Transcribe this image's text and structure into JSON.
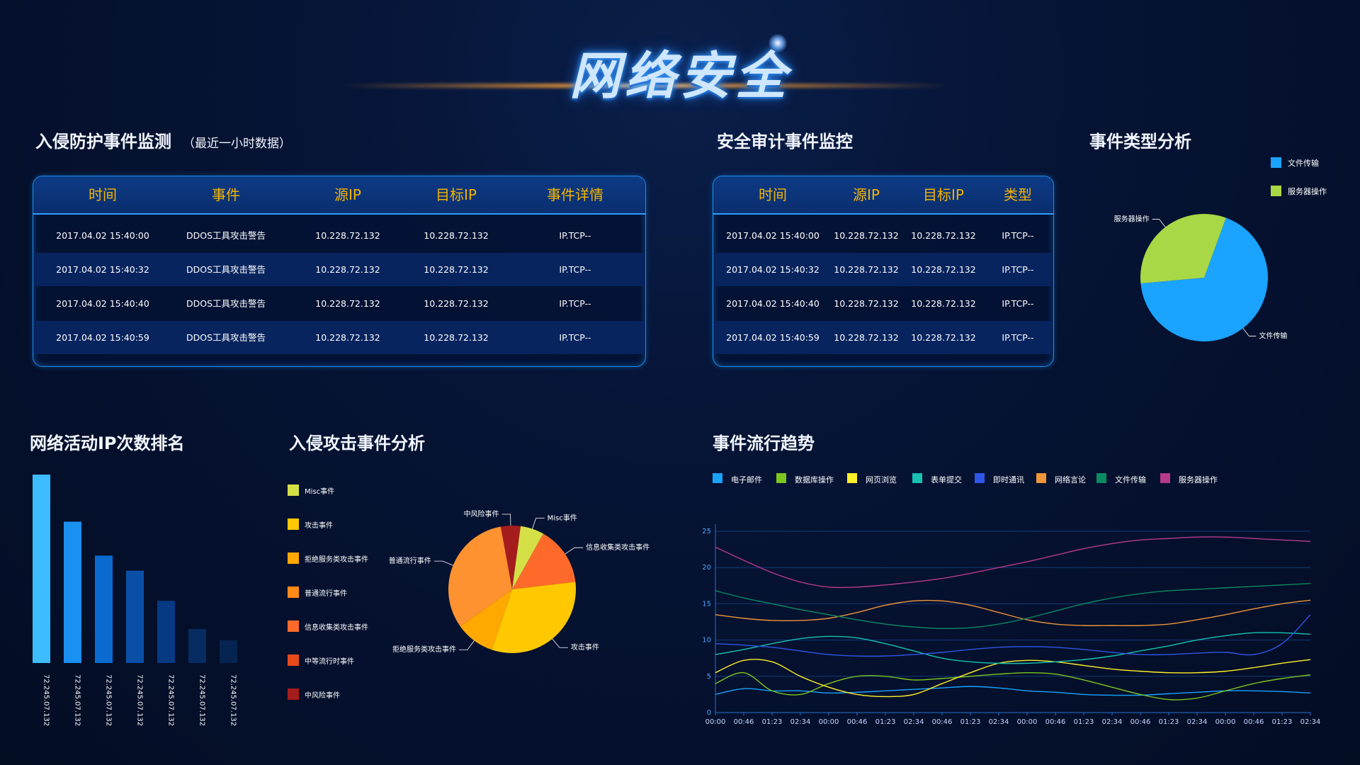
{
  "header": {
    "title": "网络安全"
  },
  "intrusion": {
    "title": "入侵防护事件监测",
    "subtitle": "（最近一小时数据）",
    "columns": [
      "时间",
      "事件",
      "源IP",
      "目标IP",
      "事件详情"
    ],
    "rows": [
      [
        "2017.04.02  15:40:00",
        "DDOS工具攻击警告",
        "10.228.72.132",
        "10.228.72.132",
        "IP.TCP--"
      ],
      [
        "2017.04.02  15:40:32",
        "DDOS工具攻击警告",
        "10.228.72.132",
        "10.228.72.132",
        "IP.TCP--"
      ],
      [
        "2017.04.02  15:40:40",
        "DDOS工具攻击警告",
        "10.228.72.132",
        "10.228.72.132",
        "IP.TCP--"
      ],
      [
        "2017.04.02  15:40:59",
        "DDOS工具攻击警告",
        "10.228.72.132",
        "10.228.72.132",
        "IP.TCP--"
      ]
    ]
  },
  "audit": {
    "title": "安全审计事件监控",
    "columns": [
      "时间",
      "源IP",
      "目标IP",
      "类型"
    ],
    "rows": [
      [
        "2017.04.02  15:40:00",
        "10.228.72.132",
        "10.228.72.132",
        "IP.TCP--"
      ],
      [
        "2017.04.02  15:40:32",
        "10.228.72.132",
        "10.228.72.132",
        "IP.TCP--"
      ],
      [
        "2017.04.02  15:40:40",
        "10.228.72.132",
        "10.228.72.132",
        "IP.TCP--"
      ],
      [
        "2017.04.02  15:40:59",
        "10.228.72.132",
        "10.228.72.132",
        "IP.TCP--"
      ]
    ]
  },
  "event_type": {
    "title": "事件类型分析"
  },
  "ip_rank": {
    "title": "网络活动IP次数排名"
  },
  "attack": {
    "title": "入侵攻击事件分析"
  },
  "trend": {
    "title": "事件流行趋势"
  },
  "chart_data": [
    {
      "type": "pie",
      "labels": [
        "文件传输",
        "服务器操作"
      ],
      "values": [
        68,
        32
      ],
      "colors": [
        "#1aa3ff",
        "#a8d845"
      ],
      "legend": [
        "文件传输",
        "服务器操作"
      ],
      "legend_position": "top-right"
    },
    {
      "type": "bar",
      "categories": [
        "72.245.07.132",
        "72.245.07.132",
        "72.245.07.132",
        "72.245.07.132",
        "72.245.07.132",
        "72.245.07.132",
        "72.245.07.132"
      ],
      "values": [
        100,
        75,
        57,
        49,
        33,
        18,
        12
      ],
      "colors": [
        "#3dbcff",
        "#1a90f0",
        "#0a6ad0",
        "#0a4fa6",
        "#073a82",
        "#062c62",
        "#052450"
      ]
    },
    {
      "type": "pie",
      "labels": [
        "中风险事件",
        "Misc事件",
        "信息收集类攻击事件",
        "攻击事件",
        "拒绝服务类攻击事件",
        "普通流行事件",
        "中等流行时事件"
      ],
      "values": [
        5,
        6,
        15,
        32,
        10,
        32,
        0
      ],
      "colors": [
        "#a51c1c",
        "#d4e046",
        "#ff6a2a",
        "#ffc800",
        "#ffa800",
        "#ff9230",
        "#e64a1a"
      ],
      "legend": [
        "Misc事件",
        "攻击事件",
        "拒绝服务类攻击事件",
        "普通流行事件",
        "信息收集类攻击事件",
        "中等流行时事件",
        "中风险事件"
      ],
      "legend_colors": [
        "#d4e046",
        "#ffc800",
        "#ffa800",
        "#ff8a18",
        "#ff6a2a",
        "#e84a1c",
        "#a51c1c"
      ],
      "legend_position": "left"
    },
    {
      "type": "line",
      "x": [
        "00:00",
        "00:46",
        "01:23",
        "02:34",
        "00:00",
        "00:46",
        "01:23",
        "02:34",
        "00:46",
        "01:23",
        "02:34",
        "00:00",
        "00:46",
        "01:23",
        "02:34",
        "00:46",
        "01:23",
        "02:34",
        "00:00",
        "00:46",
        "01:23",
        "02:34"
      ],
      "ylim": [
        0,
        25
      ],
      "yticks": [
        0,
        5,
        10,
        15,
        20,
        25
      ],
      "series": [
        {
          "name": "电子邮件",
          "color": "#1aa3ff",
          "values": [
            2.5,
            3.3,
            3.0,
            3.0,
            2.7,
            2.8,
            3.0,
            3.2,
            3.4,
            3.6,
            3.4,
            3.0,
            2.8,
            2.5,
            2.4,
            2.4,
            2.6,
            2.8,
            3.0,
            3.0,
            2.9,
            2.7
          ]
        },
        {
          "name": "数据库操作",
          "color": "#7cc620",
          "values": [
            4.0,
            5.5,
            3.0,
            2.5,
            4.0,
            5.0,
            5.0,
            4.5,
            4.7,
            5.0,
            5.3,
            5.5,
            5.3,
            4.5,
            3.5,
            2.5,
            1.8,
            2.0,
            3.0,
            4.0,
            4.7,
            5.2
          ]
        },
        {
          "name": "网页浏览",
          "color": "#ffef2a",
          "values": [
            5.5,
            7.2,
            7.0,
            5.0,
            3.5,
            2.5,
            2.2,
            2.5,
            4.0,
            5.5,
            6.8,
            7.2,
            7.0,
            6.5,
            6.0,
            5.7,
            5.5,
            5.5,
            5.7,
            6.2,
            6.8,
            7.3
          ]
        },
        {
          "name": "表单提交",
          "color": "#16c2b0",
          "values": [
            8.0,
            8.7,
            9.5,
            10.2,
            10.5,
            10.3,
            9.5,
            8.5,
            7.5,
            7.0,
            6.8,
            6.8,
            7.0,
            7.3,
            7.8,
            8.5,
            9.2,
            10.0,
            10.6,
            11.0,
            11.0,
            10.8
          ]
        },
        {
          "name": "即时通讯",
          "color": "#2f56e6",
          "values": [
            9.5,
            9.3,
            9.0,
            8.5,
            8.0,
            7.8,
            7.8,
            8.0,
            8.3,
            8.7,
            9.0,
            9.1,
            9.0,
            8.7,
            8.3,
            8.0,
            8.0,
            8.2,
            8.3,
            8.0,
            9.5,
            13.5
          ]
        },
        {
          "name": "网络言论",
          "color": "#f0953a",
          "values": [
            13.5,
            13.0,
            12.7,
            12.7,
            13.0,
            13.8,
            14.8,
            15.4,
            15.4,
            14.8,
            13.8,
            12.8,
            12.2,
            12.0,
            12.0,
            12.0,
            12.2,
            12.8,
            13.5,
            14.3,
            15.0,
            15.5
          ]
        },
        {
          "name": "文件传输",
          "color": "#0a8a63",
          "values": [
            16.8,
            15.8,
            15.0,
            14.2,
            13.5,
            12.8,
            12.2,
            11.8,
            11.6,
            11.7,
            12.2,
            13.0,
            14.0,
            15.0,
            15.8,
            16.4,
            16.8,
            17.0,
            17.2,
            17.4,
            17.6,
            17.8
          ]
        },
        {
          "name": "服务器操作",
          "color": "#b83a8c",
          "values": [
            22.8,
            21.0,
            19.3,
            18.0,
            17.3,
            17.3,
            17.6,
            18.0,
            18.5,
            19.2,
            20.0,
            20.8,
            21.7,
            22.6,
            23.3,
            23.8,
            24.0,
            24.2,
            24.2,
            24.0,
            23.8,
            23.6
          ]
        }
      ]
    }
  ]
}
